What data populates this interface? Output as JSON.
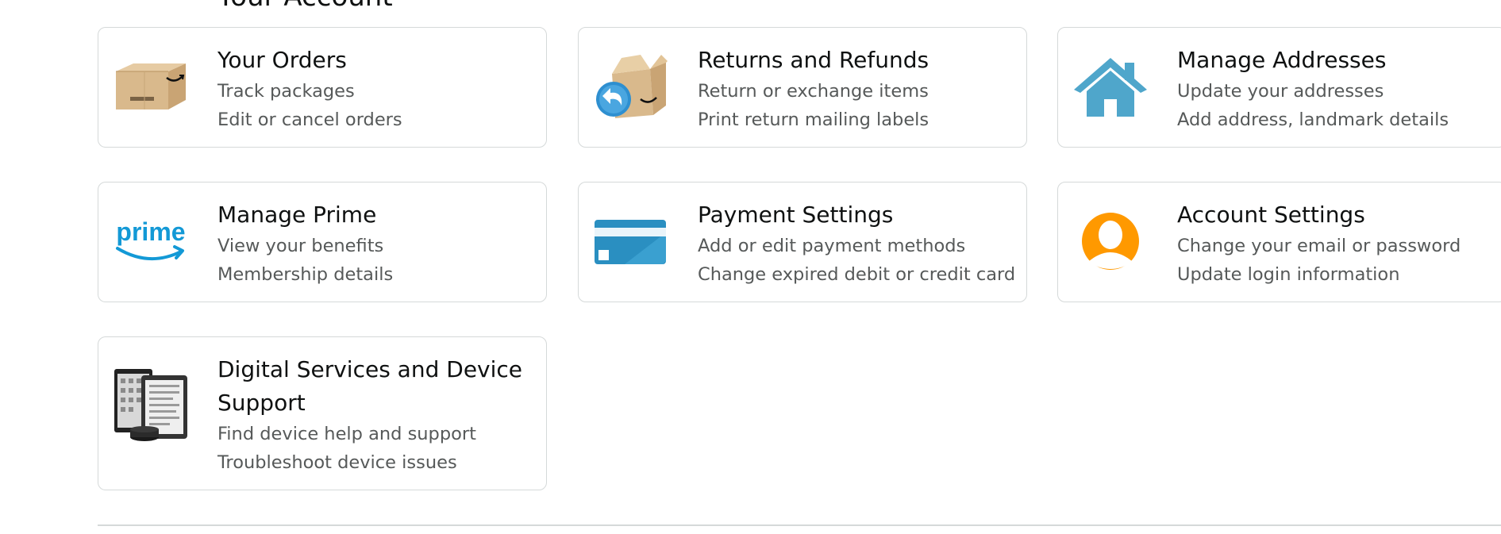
{
  "page": {
    "heading_fragment": "Your Account"
  },
  "cards": {
    "orders": {
      "title": "Your Orders",
      "lines": [
        "Track packages",
        "Edit or cancel orders"
      ],
      "icon": "amazon-box-icon"
    },
    "returns": {
      "title": "Returns and Refunds",
      "lines": [
        "Return or exchange items",
        "Print return mailing labels"
      ],
      "icon": "return-box-icon"
    },
    "addresses": {
      "title": "Manage Addresses",
      "lines": [
        "Update your addresses",
        "Add address, landmark details"
      ],
      "icon": "house-icon"
    },
    "prime": {
      "title": "Manage Prime",
      "lines": [
        "View your benefits",
        "Membership details"
      ],
      "icon": "prime-logo-icon",
      "logo_text": "prime"
    },
    "payment": {
      "title": "Payment Settings",
      "lines": [
        "Add or edit payment methods",
        "Change expired debit or credit card"
      ],
      "icon": "credit-card-icon"
    },
    "account": {
      "title": "Account Settings",
      "lines": [
        "Change your email or password",
        "Update login information"
      ],
      "icon": "user-avatar-icon"
    },
    "digital": {
      "title": "Digital Services and Device Support",
      "lines": [
        "Find device help and support",
        "Troubleshoot device issues"
      ],
      "icon": "devices-icon"
    }
  },
  "colors": {
    "border": "#d5d9d9",
    "title_text": "#0f1111",
    "secondary_text": "#565959",
    "prime_blue": "#1399d6",
    "house_blue": "#4fa6cb",
    "card_blue": "#2a8fc1",
    "avatar_orange": "#ff9900",
    "box_tan": "#d9b98c"
  }
}
